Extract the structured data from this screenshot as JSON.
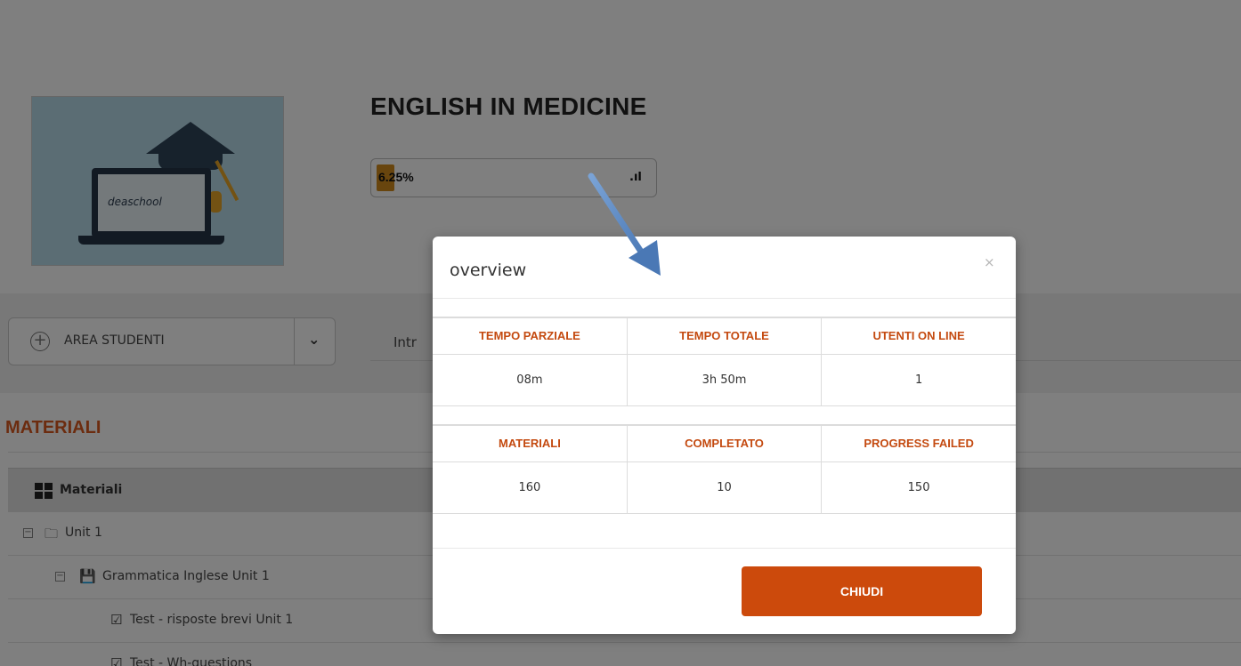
{
  "course": {
    "title": "ENGLISH IN MEDICINE",
    "image_brand": "deaschool",
    "progress_pct": "6.25%",
    "progress_value": 0.0625,
    "progress_icon": ".ıl"
  },
  "area_select": {
    "label": "AREA STUDENTI",
    "plus_icon": "+",
    "chevron_icon": "⌄"
  },
  "tabs": {
    "intro": "Intr"
  },
  "materials": {
    "heading": "MATERIALI",
    "table_header": "Materiali",
    "rows": [
      {
        "label": "Unit 1",
        "toggle": "−"
      },
      {
        "label": "Grammatica Inglese Unit 1",
        "toggle": "−"
      },
      {
        "label": "Test - risposte brevi Unit 1"
      },
      {
        "label": "Test - Wh-questions"
      }
    ]
  },
  "modal": {
    "title": "overview",
    "close_icon": "×",
    "table1": {
      "headers": [
        "TEMPO PARZIALE",
        "TEMPO TOTALE",
        "UTENTI ON LINE"
      ],
      "values": [
        "08m",
        "3h 50m",
        "1"
      ]
    },
    "table2": {
      "headers": [
        "MATERIALI",
        "COMPLETATO",
        "PROGRESS FAILED"
      ],
      "values": [
        "160",
        "10",
        "150"
      ]
    },
    "button_label": "CHIUDI"
  },
  "colors": {
    "accent": "#cc4a0c",
    "header_text": "#c44a10",
    "progress_fill": "#d08a1c",
    "overlay": "rgba(0,0,0,0.5)",
    "annotation_arrow": "#4a78b5"
  }
}
